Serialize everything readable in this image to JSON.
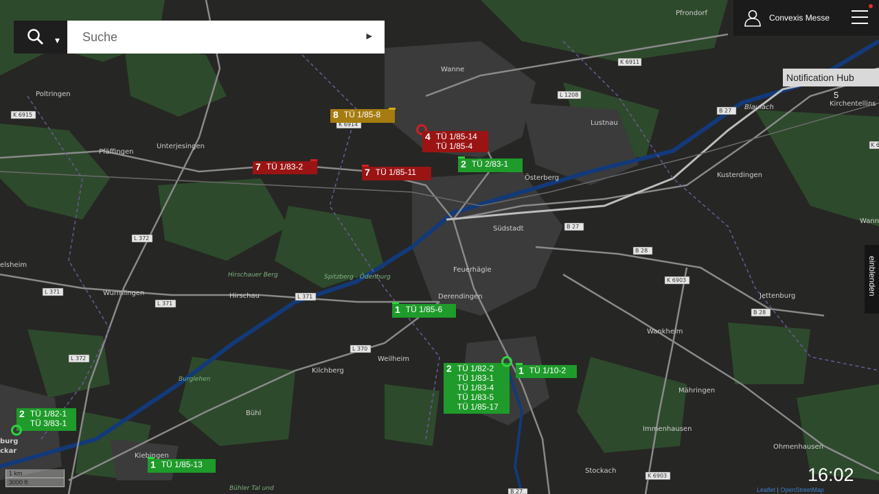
{
  "search": {
    "placeholder": "Suche"
  },
  "user": {
    "name": "Convexis Messe"
  },
  "notification_hub": {
    "label": "Notification Hub",
    "count": "5"
  },
  "side_panel": {
    "label": "einblenden"
  },
  "clock": "16:02",
  "scale": {
    "metric": "1 km",
    "imperial": "3000 ft"
  },
  "attribution": {
    "leaflet": "Leaflet",
    "osm": "OpenStreetMap"
  },
  "places": [
    {
      "name": "Pfrondorf"
    },
    {
      "name": "Wanne"
    },
    {
      "name": "Lustnau"
    },
    {
      "name": "Poltringen"
    },
    {
      "name": "Pfäffingen"
    },
    {
      "name": "Unterjesingen"
    },
    {
      "name": "Österberg"
    },
    {
      "name": "Kusterdingen"
    },
    {
      "name": "Südstadt"
    },
    {
      "name": "Feuerhägle"
    },
    {
      "name": "Derendingen"
    },
    {
      "name": "Wurmlingen"
    },
    {
      "name": "Hirschau"
    },
    {
      "name": "Jettenburg"
    },
    {
      "name": "Wankheim"
    },
    {
      "name": "Weilheim"
    },
    {
      "name": "Kilchberg"
    },
    {
      "name": "Bühl"
    },
    {
      "name": "Mähringen"
    },
    {
      "name": "Immenhausen"
    },
    {
      "name": "Ohmenhausen"
    },
    {
      "name": "Stockach"
    },
    {
      "name": "Kiebingen"
    },
    {
      "name": "elsheim"
    },
    {
      "name": "burg"
    },
    {
      "name": "ckar"
    },
    {
      "name": "Blaulach"
    },
    {
      "name": "Kirchentellins"
    },
    {
      "name": "Wann"
    }
  ],
  "park_labels": [
    {
      "name": "Hirschauer Berg"
    },
    {
      "name": "Spitzberg - Ödenburg"
    },
    {
      "name": "Burglehen"
    },
    {
      "name": "Bühler Tal und"
    }
  ],
  "road_labels": [
    {
      "ref": "K 6911"
    },
    {
      "ref": "L 1208"
    },
    {
      "ref": "B 27"
    },
    {
      "ref": "K 6915"
    },
    {
      "ref": "K 6914"
    },
    {
      "ref": "L 372"
    },
    {
      "ref": "L 371"
    },
    {
      "ref": "L 371"
    },
    {
      "ref": "L 371"
    },
    {
      "ref": "L 370"
    },
    {
      "ref": "L 372"
    },
    {
      "ref": "B 27"
    },
    {
      "ref": "B 28"
    },
    {
      "ref": "K 6903"
    },
    {
      "ref": "B 28"
    },
    {
      "ref": "K 6903"
    },
    {
      "ref": "B 27"
    },
    {
      "ref": "K 6"
    }
  ],
  "markers": [
    {
      "count": "8",
      "labels": [
        "TÜ 1/85-8"
      ],
      "status_color": "#a57c10"
    },
    {
      "count": "4",
      "labels": [
        "TÜ 1/85-14",
        "TÜ 1/85-4"
      ],
      "status_color": "#9a1414"
    },
    {
      "count": "7",
      "labels": [
        "TÜ 1/83-2"
      ],
      "status_color": "#9a1414"
    },
    {
      "count": "7",
      "labels": [
        "TÜ 1/85-11"
      ],
      "status_color": "#9a1414"
    },
    {
      "count": "2",
      "labels": [
        "TÜ 2/83-1"
      ],
      "status_color": "#1e9b2a"
    },
    {
      "count": "1",
      "labels": [
        "TÜ 1/85-6"
      ],
      "status_color": "#1e9b2a"
    },
    {
      "count": "2",
      "labels": [
        "TÜ 1/82-2",
        "TÜ 1/83-1",
        "TÜ 1/83-4",
        "TÜ 1/83-5",
        "TÜ 1/85-17"
      ],
      "status_color": "#1e9b2a"
    },
    {
      "count": "1",
      "labels": [
        "TÜ 1/10-2"
      ],
      "status_color": "#1e9b2a"
    },
    {
      "count": "2",
      "labels": [
        "TÜ 1/82-1",
        "TÜ 3/83-1"
      ],
      "status_color": "#1e9b2a"
    },
    {
      "count": "1",
      "labels": [
        "TÜ 1/85-13"
      ],
      "status_color": "#1e9b2a"
    }
  ],
  "colors": {
    "background": "#262624",
    "forest": "#2e4a2c",
    "urban": "#3a3a3a",
    "river": "#123a7a",
    "road": "#9a9a9a",
    "boundary": "#6a5a9a",
    "marker_ok": "#1e9b2a",
    "marker_alert": "#9a1414",
    "marker_warn": "#a57c10"
  },
  "icons": [
    "search-icon",
    "user-icon",
    "menu-icon",
    "play-arrow-icon",
    "notification-dot-icon"
  ]
}
